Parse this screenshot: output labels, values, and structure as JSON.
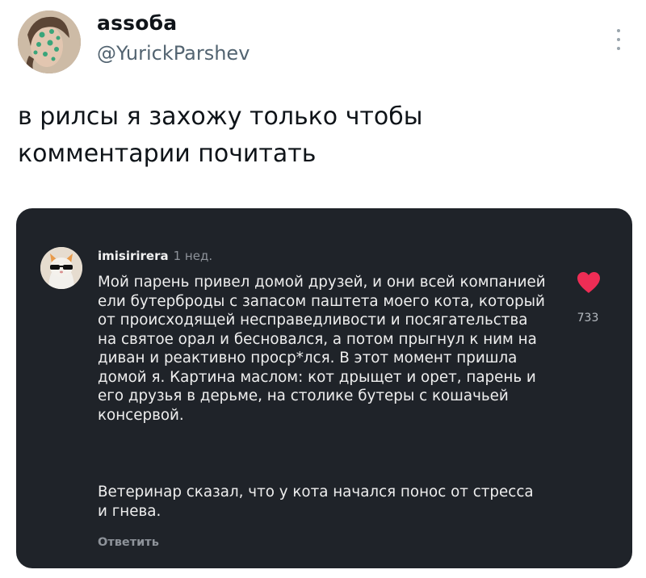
{
  "tweet": {
    "display_name": "assoбa",
    "handle": "@YurickParshev",
    "text": "в рилсы я захожу только чтобы\nкомментарии почитать"
  },
  "comment": {
    "username": "imisirirera",
    "time": "1 нед.",
    "text_1": "Мой парень привел домой друзей, и они всей компанией ели бутерброды с запасом паштета моего кота, который от происходящей несправедливости и посягательства на святое орал и бесновался, а потом прыгнул к ним на диван и реактивно проср*лся. В этот момент пришла домой я. Картина маслом: кот дрыщет и орет, парень и его друзья в дерьме, на столике бутеры с кошачьей консервой.",
    "text_2": "Ветеринар сказал, что у кота начался понос от стресса и гнева.",
    "reply_label": "Ответить",
    "like_count": "733",
    "like_icon": "heart-icon",
    "like_color": "#ee2d55"
  },
  "colors": {
    "card_bg": "#1f2329",
    "handle": "#536471"
  }
}
